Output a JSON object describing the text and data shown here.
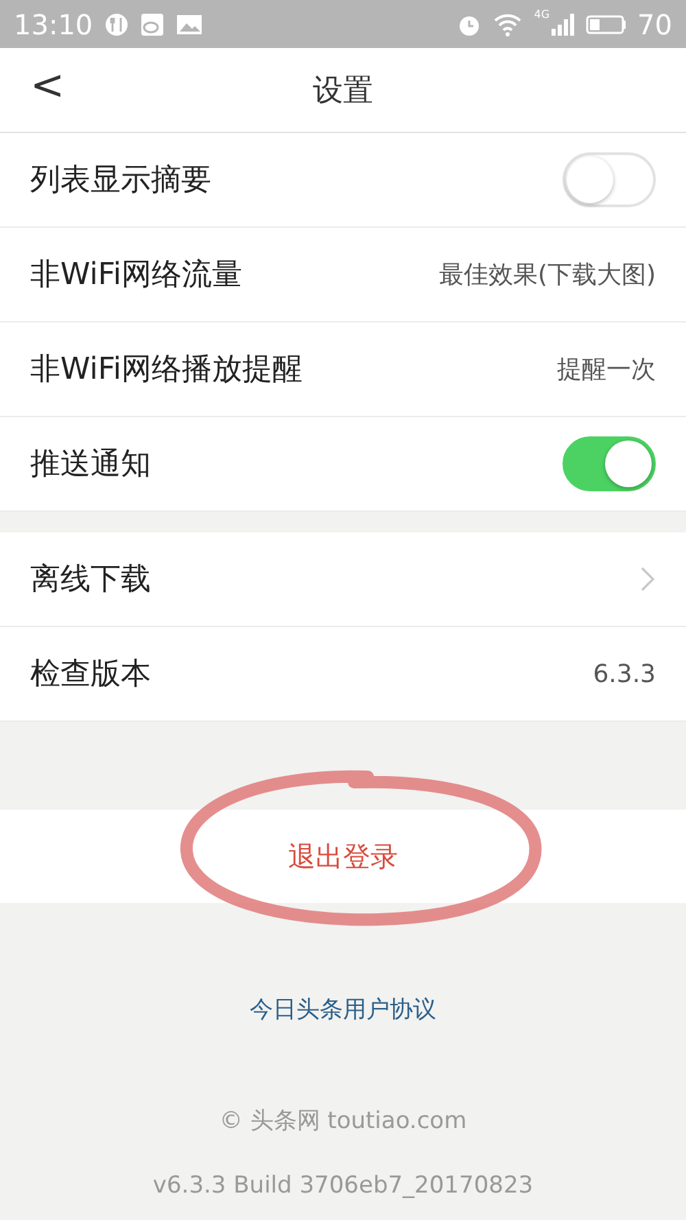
{
  "status_bar": {
    "time": "13:10",
    "network": "4G",
    "battery": "70"
  },
  "nav": {
    "back": "<",
    "title": "设置"
  },
  "groups": [
    {
      "rows": [
        {
          "kind": "toggle",
          "label": "列表显示摘要",
          "on": false
        },
        {
          "kind": "value",
          "label": "非WiFi网络流量",
          "value": "最佳效果(下载大图)"
        },
        {
          "kind": "value",
          "label": "非WiFi网络播放提醒",
          "value": "提醒一次"
        },
        {
          "kind": "toggle",
          "label": "推送通知",
          "on": true
        }
      ]
    },
    {
      "rows": [
        {
          "kind": "chevron",
          "label": "离线下载"
        },
        {
          "kind": "value",
          "label": "检查版本",
          "value": "6.3.3"
        }
      ]
    }
  ],
  "logout": "退出登录",
  "agreement": "今日头条用户协议",
  "copyright": "© 头条网 toutiao.com",
  "build": "v6.3.3 Build 3706eb7_20170823"
}
